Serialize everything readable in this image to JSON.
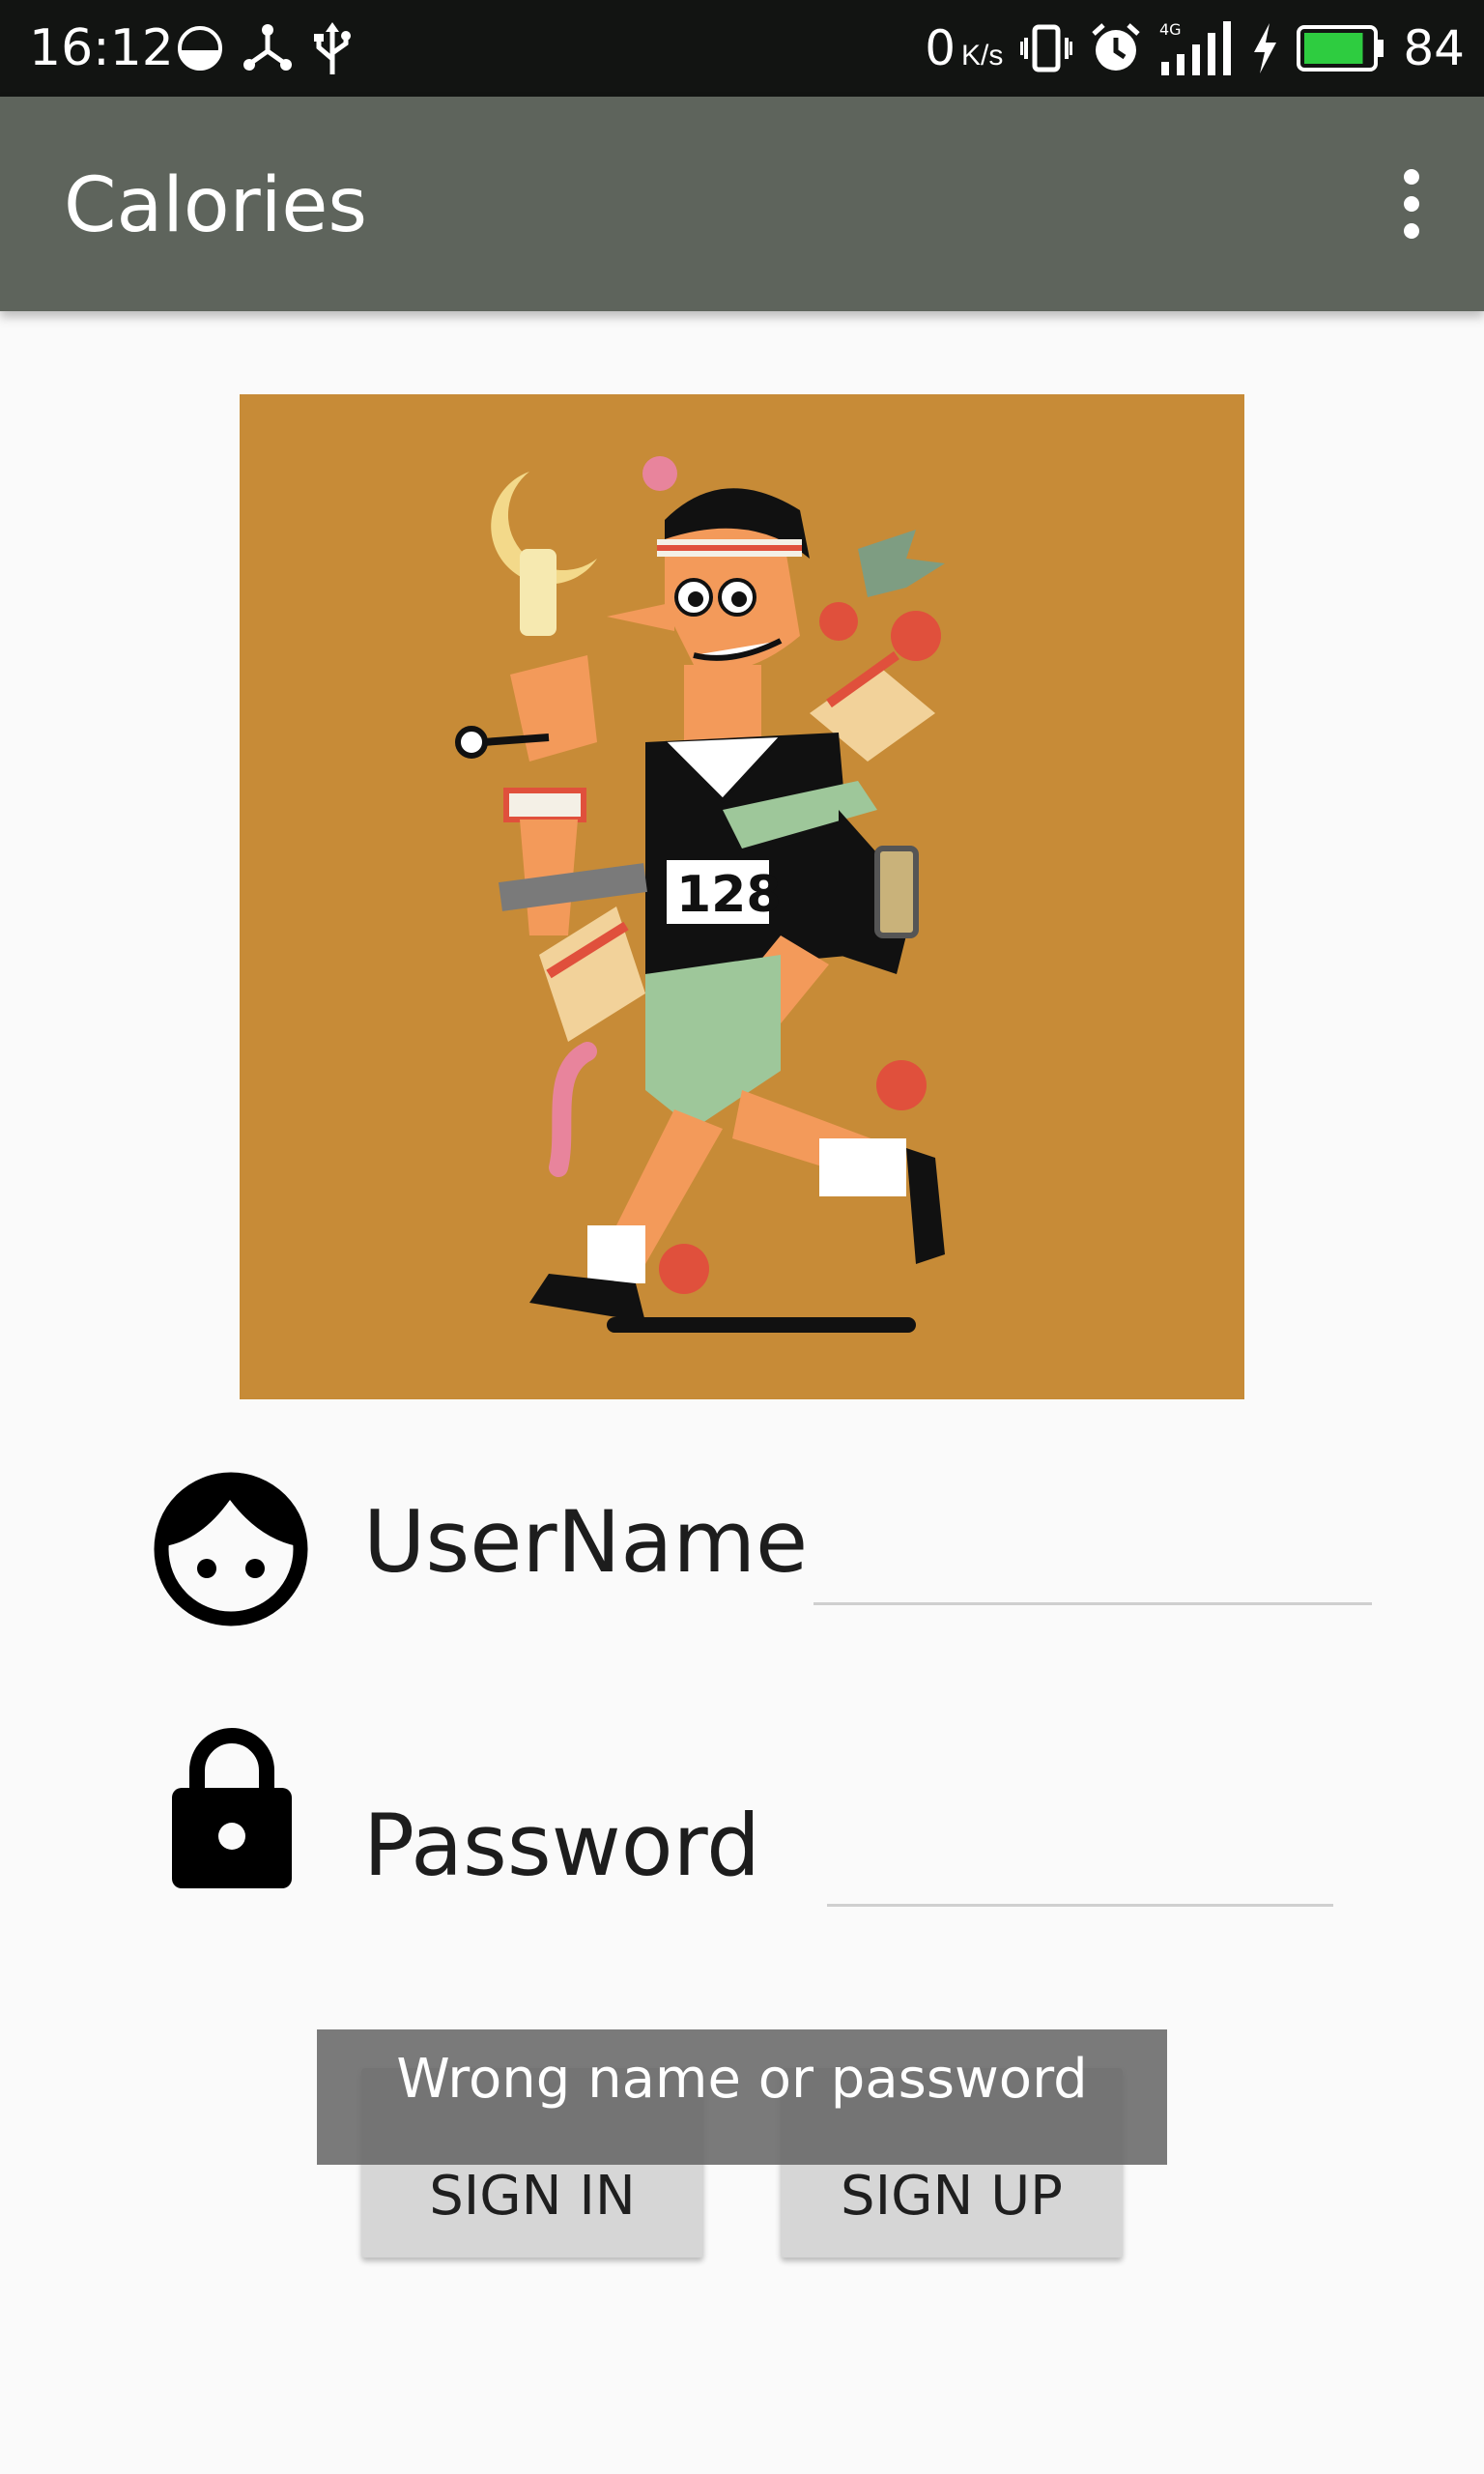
{
  "status_bar": {
    "time": "16:12",
    "network_speed": "0",
    "network_speed_unit": "K/s",
    "network_type": "4G",
    "battery_percent": "84",
    "battery_level": 0.84,
    "battery_color": "#2ecc40",
    "icons": [
      "data-saver-icon",
      "usb-connected-icon",
      "usb-icon",
      "vibrate-icon",
      "alarm-icon",
      "signal-icon",
      "charging-icon",
      "battery-icon"
    ]
  },
  "app_bar": {
    "title": "Calories",
    "overflow_icon": "more-vert-icon",
    "background": "#5e645c"
  },
  "illustration": {
    "background": "#c78b37",
    "bib_number": "128"
  },
  "form": {
    "username": {
      "label": "UserName",
      "value": "",
      "icon": "face-icon"
    },
    "password": {
      "label": "Password",
      "value": "",
      "icon": "lock-icon"
    }
  },
  "buttons": {
    "sign_in": "SIGN IN",
    "sign_up": "SIGN UP"
  },
  "toast": {
    "message": "Wrong name or password"
  }
}
